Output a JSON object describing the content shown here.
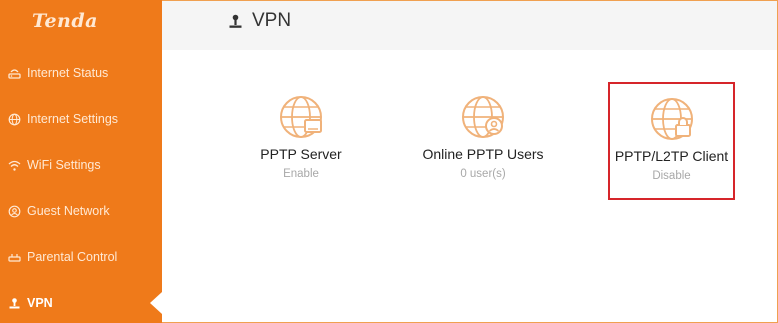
{
  "brand": {
    "logo_text": "Tenda"
  },
  "sidebar": {
    "items": [
      {
        "label": "Internet Status",
        "icon": "router-icon",
        "active": false
      },
      {
        "label": "Internet Settings",
        "icon": "globe-icon",
        "active": false
      },
      {
        "label": "WiFi Settings",
        "icon": "wifi-icon",
        "active": false
      },
      {
        "label": "Guest Network",
        "icon": "guest-icon",
        "active": false
      },
      {
        "label": "Parental Control",
        "icon": "parental-control-icon",
        "active": false
      },
      {
        "label": "VPN",
        "icon": "vpn-icon",
        "active": true
      }
    ]
  },
  "header": {
    "title": "VPN",
    "icon": "vpn-icon"
  },
  "cards": [
    {
      "title": "PPTP Server",
      "subtitle": "Enable",
      "icon": "globe-server-icon"
    },
    {
      "title": "Online PPTP Users",
      "subtitle": "0 user(s)",
      "icon": "globe-user-icon"
    },
    {
      "title": "PPTP/L2TP Client",
      "subtitle": "Disable",
      "icon": "globe-lock-icon"
    }
  ],
  "colors": {
    "sidebar_bg": "#ef7a1a",
    "accent_icon": "#f0b27a",
    "highlight_border": "#d6252a",
    "header_bg": "#f5f5f5"
  }
}
